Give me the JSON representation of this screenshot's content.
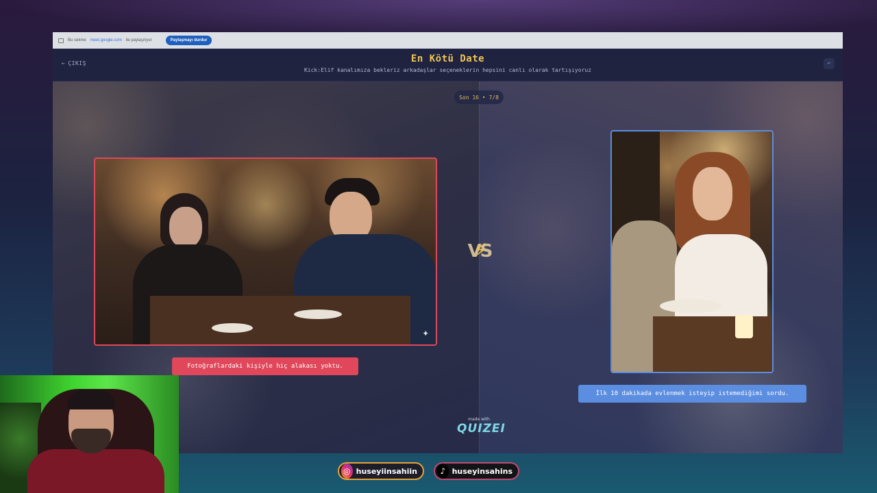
{
  "browser": {
    "share_text_prefix": "Bu sekme",
    "share_url": "meet.google.com",
    "share_text_suffix": "ile paylaşılıyor",
    "stop_sharing_label": "Paylaşmayı durdur"
  },
  "header": {
    "exit_label": "ÇIKIŞ",
    "title": "En Kötü Date",
    "subtitle": "Kick:Elif kanalımıza bekleriz arkadaşlar seçeneklerin hepsini canlı olarak tartışıyoruz"
  },
  "round": {
    "label": "Son 16 • 7/8"
  },
  "options": [
    {
      "caption": "Fotoğraflardaki kişiyle hiç alakası yoktu.",
      "accent": "#e0475a"
    },
    {
      "caption": "İlk 10 dakikada evlenmek isteyip istemediğimi sordu.",
      "accent": "#5b8de0"
    }
  ],
  "vs_label": "VS",
  "branding": {
    "made_with": "made with",
    "name": "QUIZEI"
  },
  "social": {
    "instagram": {
      "handle": "huseyiinsahiin",
      "icon": "instagram-icon"
    },
    "tiktok": {
      "handle": "huseyinsahins",
      "icon": "tiktok-icon"
    }
  }
}
